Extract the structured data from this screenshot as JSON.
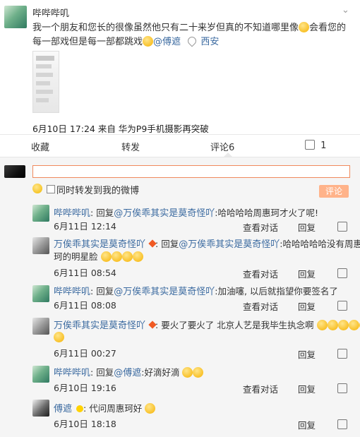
{
  "post": {
    "author": "哔哔哔叽",
    "text": "我一个朋友和您长的很像虽然他只有二十来岁但真的不知道哪里像",
    "text2": "会看您的每一部戏但是每一部都跳戏",
    "mention": "@傅遮",
    "location": "西安",
    "time_source": "6月10日 17:24 来自 华为P9手机摄影再突破"
  },
  "actions": {
    "favorite": "收藏",
    "forward": "转发",
    "comment": "评论6",
    "like_count": "1"
  },
  "compose": {
    "checkbox_label": "同时转发到我的微博",
    "submit_label": "评论"
  },
  "comments": [
    {
      "author": "哔哔哔叽",
      "reply_to": "@万俟乖其实是莫奇怪吖",
      "text": ":哈哈哈哈周惠珂才火了呢!",
      "time": "6月11日 12:14",
      "view": "查看对话",
      "reply": "回复"
    },
    {
      "author": "万俟乖其实是莫奇怪吖",
      "reply_to": "@万俟乖其实是莫奇怪吖",
      "text": ":哈哈哈哈哈没有周惠",
      "text2": "珂的明星脸",
      "time": "6月11日 08:54",
      "view": "查看对话",
      "reply": "回复"
    },
    {
      "author": "哔哔哔叽",
      "reply_to": "@万俟乖其实是莫奇怪吖",
      "text": ":加油噻, 以后就指望你要签名了",
      "time": "6月11日 08:08",
      "view": "查看对话",
      "reply": "回复"
    },
    {
      "author": "万俟乖其实是莫奇怪吖",
      "text": "要火了要火了 北京人艺是我毕生执念啊",
      "time": "6月11日 00:27",
      "reply": "回复"
    },
    {
      "author": "哔哔哔叽",
      "reply_to": "@傅遮",
      "text": ":好滴好滴",
      "time": "6月10日 19:16",
      "view": "查看对话",
      "reply": "回复"
    },
    {
      "author": "傅遮",
      "text": "代问周惠珂好",
      "time": "6月10日 18:18",
      "reply": "回复"
    }
  ],
  "labels": {
    "reply_prefix": "回复",
    "colon": ":"
  }
}
